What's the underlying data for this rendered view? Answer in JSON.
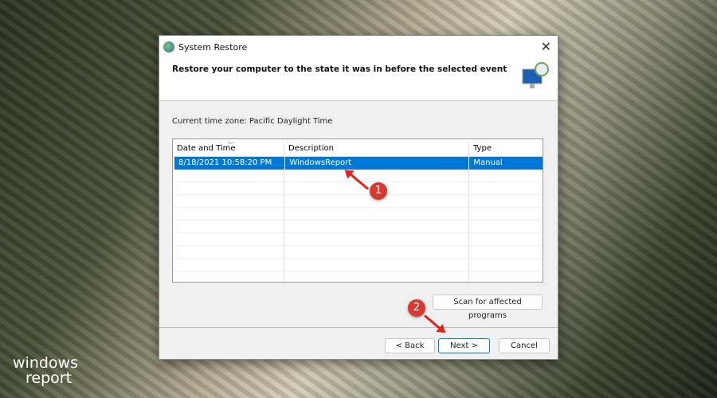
{
  "dialog": {
    "title": "System Restore",
    "heading": "Restore your computer to the state it was in before the selected event",
    "timezone": "Current time zone: Pacific Daylight Time",
    "columns": [
      "Date and Time",
      "Description",
      "Type"
    ],
    "rows": [
      {
        "date": "8/18/2021 10:58:20 PM",
        "description": "WindowsReport",
        "type": "Manual",
        "selected": true
      }
    ],
    "scan_button": "Scan for affected programs",
    "back_button": "< Back",
    "next_button": "Next >",
    "cancel_button": "Cancel",
    "close": "✕"
  },
  "annotations": [
    "1",
    "2"
  ],
  "logo": {
    "line1": "windows",
    "line2": "report"
  },
  "colors": {
    "selection": "#0078d7",
    "annotation": "#d63a30"
  }
}
